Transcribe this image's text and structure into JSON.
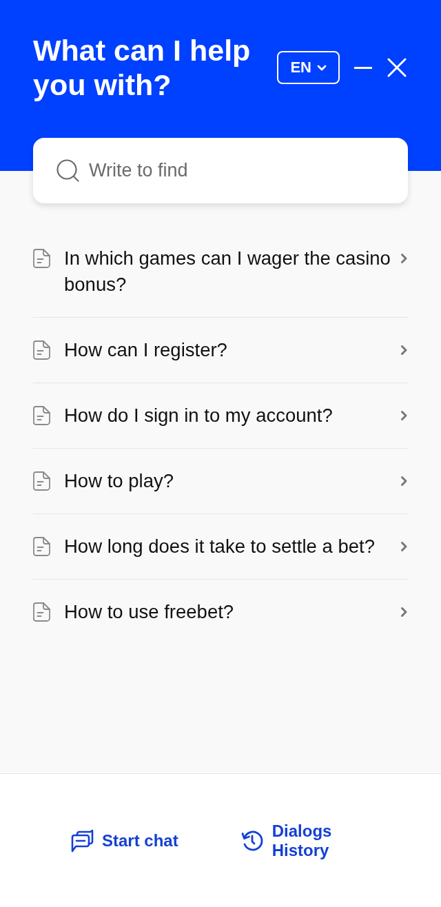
{
  "header": {
    "title": "What can I help you with?",
    "language": "EN"
  },
  "search": {
    "placeholder": "Write to find"
  },
  "articles": [
    {
      "title": "In which games can I wager the casino bonus?"
    },
    {
      "title": "How can I register?"
    },
    {
      "title": "How do I sign in to my account?"
    },
    {
      "title": "How to play?"
    },
    {
      "title": "How long does it take to settle a bet?"
    },
    {
      "title": "How to use freebet?"
    }
  ],
  "footer": {
    "actions": [
      {
        "kind": "chat",
        "label": "Start chat"
      },
      {
        "kind": "history",
        "label": "Dialogs History"
      }
    ]
  }
}
